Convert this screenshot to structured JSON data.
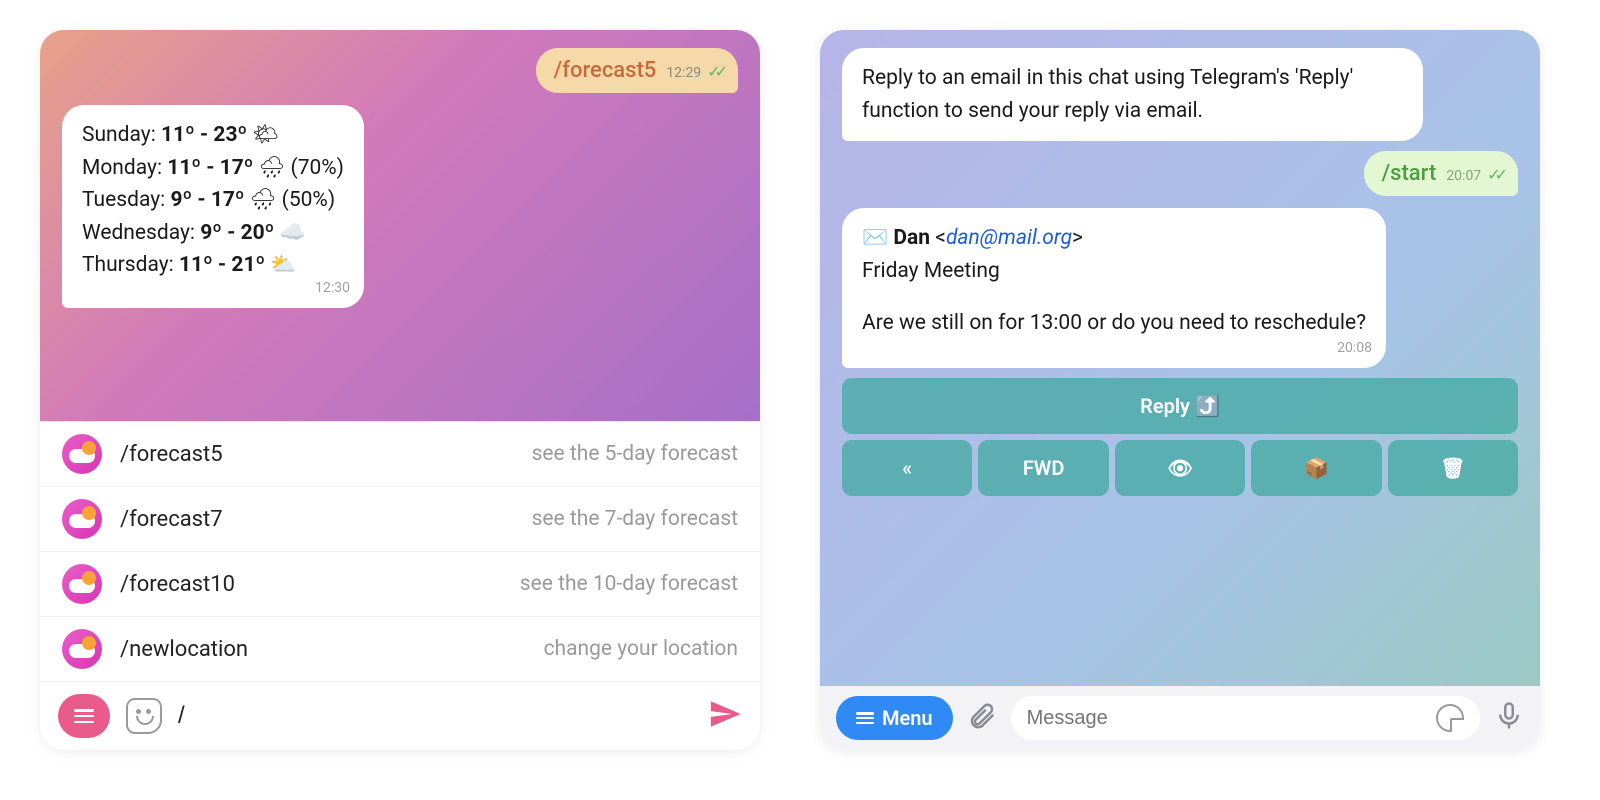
{
  "left": {
    "outgoing": {
      "command": "/forecast5",
      "time": "12:29"
    },
    "forecast": {
      "rows": [
        {
          "day": "Sunday:",
          "temps": "11º - 23º",
          "icon": "🌤",
          "extra": ""
        },
        {
          "day": "Monday:",
          "temps": "11º - 17º",
          "icon": "🌧",
          "extra": "(70%)"
        },
        {
          "day": "Tuesday:",
          "temps": "9º - 17º",
          "icon": "🌧",
          "extra": "(50%)"
        },
        {
          "day": "Wednesday:",
          "temps": "9º - 20º",
          "icon": "☁️",
          "extra": ""
        },
        {
          "day": "Thursday:",
          "temps": "11º - 21º",
          "icon": "⛅",
          "extra": ""
        }
      ],
      "time": "12:30"
    },
    "commands": [
      {
        "name": "/forecast5",
        "desc": "see the 5-day forecast"
      },
      {
        "name": "/forecast7",
        "desc": "see the 7-day forecast"
      },
      {
        "name": "/forecast10",
        "desc": "see the 10-day forecast"
      },
      {
        "name": "/newlocation",
        "desc": "change your location"
      }
    ],
    "input_value": "/"
  },
  "right": {
    "intro": "Reply to an email in this chat using Telegram's 'Reply' function to send your reply via email.",
    "outgoing": {
      "command": "/start",
      "time": "20:07"
    },
    "email": {
      "icon": "✉️",
      "from_name": "Dan",
      "from_addr": "dan@mail.org",
      "subject": "Friday Meeting",
      "body": "Are we still on for 13:00 or do you need to reschedule?",
      "time": "20:08"
    },
    "reply_button": "Reply ⤴️",
    "action_row": [
      "«",
      "FWD",
      "👁",
      "📦",
      "🗑"
    ],
    "menu_label": "Menu",
    "input_placeholder": "Message"
  }
}
